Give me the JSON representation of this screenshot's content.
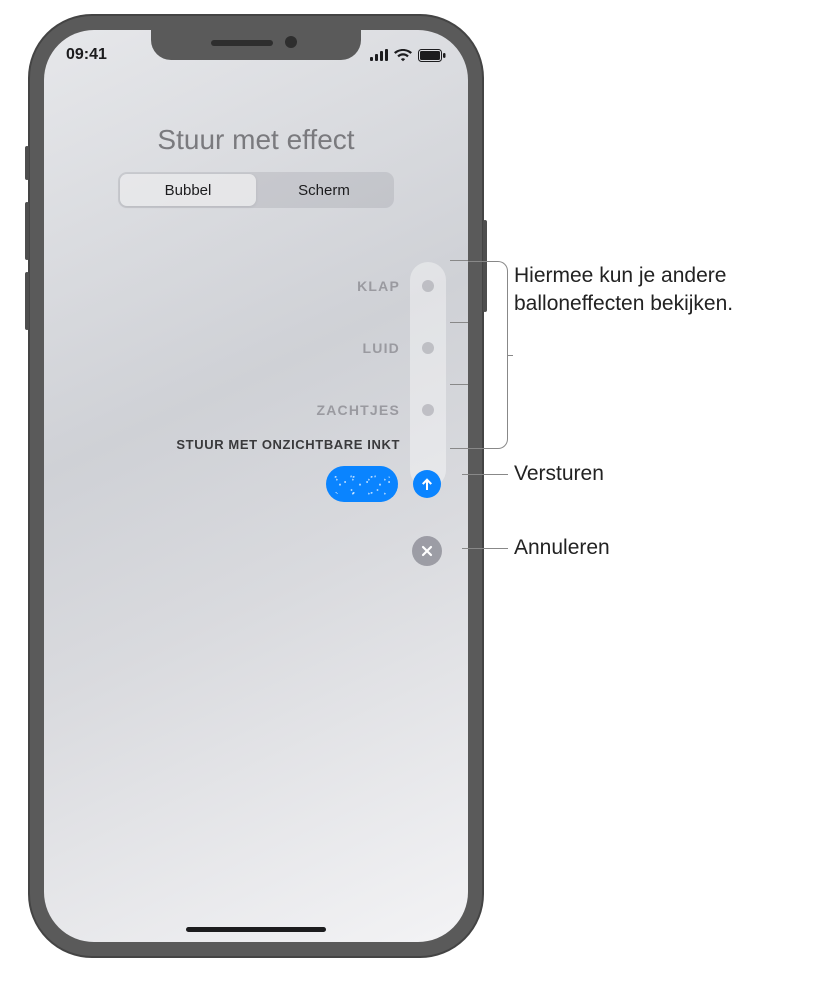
{
  "status": {
    "time": "09:41"
  },
  "header": {
    "title": "Stuur met effect"
  },
  "segmented": {
    "bubbel": "Bubbel",
    "scherm": "Scherm",
    "active": "bubbel"
  },
  "effects": {
    "klap": "KLAP",
    "luid": "LUID",
    "zachtjes": "ZACHTJES",
    "onzichtbare_inkt": "STUUR MET ONZICHTBARE INKT"
  },
  "annotations": {
    "other_effects": "Hiermee kun je andere balloneffecten bekijken.",
    "send": "Versturen",
    "cancel": "Annuleren"
  }
}
